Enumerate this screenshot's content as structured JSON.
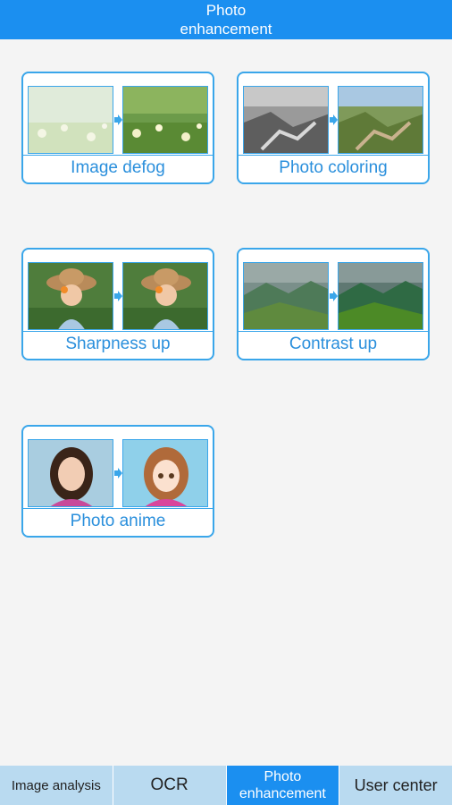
{
  "header": {
    "title_line1": "Photo",
    "title_line2": "enhancement"
  },
  "cards": [
    {
      "label": "Image defog"
    },
    {
      "label": "Photo coloring"
    },
    {
      "label": "Sharpness up"
    },
    {
      "label": "Contrast up"
    },
    {
      "label": "Photo anime"
    }
  ],
  "tabs": [
    {
      "label": "Image analysis"
    },
    {
      "label": "OCR"
    },
    {
      "label_line1": "Photo",
      "label_line2": "enhancement"
    },
    {
      "label": "User center"
    }
  ],
  "colors": {
    "accent": "#1b8ff0",
    "card_border": "#3aa6ea",
    "tabbar_bg": "#b9daf0"
  }
}
